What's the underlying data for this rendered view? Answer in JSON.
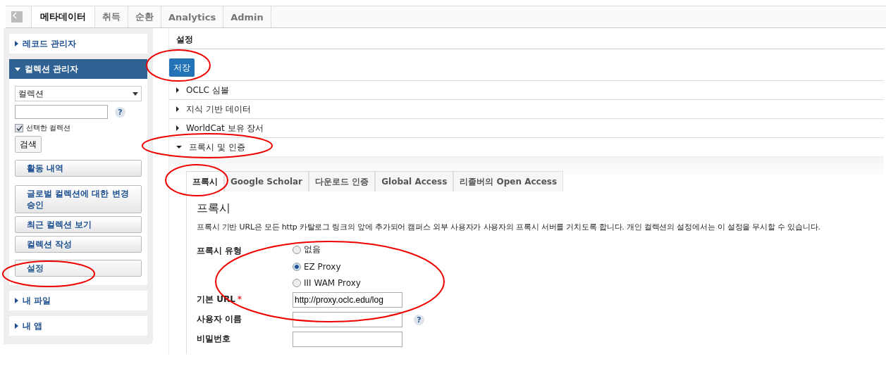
{
  "nav": {
    "tabs": [
      {
        "label": "메타데이터",
        "selected": true
      },
      {
        "label": "취득",
        "selected": false
      },
      {
        "label": "순환",
        "selected": false
      },
      {
        "label": "Analytics",
        "selected": false
      },
      {
        "label": "Admin",
        "selected": false
      }
    ]
  },
  "sidebar": {
    "panels": [
      {
        "title": "레코드 관리자",
        "expanded": false
      },
      {
        "title": "컬렉션 관리자",
        "expanded": true,
        "select": "컬렉션",
        "help": "?",
        "checkbox": {
          "label": "선택한 컬렉션",
          "checked": true
        },
        "search_button": "검색",
        "buttons": [
          {
            "label": "활동 내역",
            "selected": false
          },
          {
            "label": "글로벌 컬렉션에 대한 변경 승인",
            "selected": false
          },
          {
            "label": "최근 컬렉션 보기",
            "selected": false
          },
          {
            "label": "컬렉션 작성",
            "selected": false
          },
          {
            "label": "설정",
            "selected": true
          }
        ]
      },
      {
        "title": "내 파일",
        "expanded": false
      },
      {
        "title": "내 앱",
        "expanded": false
      }
    ]
  },
  "main": {
    "title": "설정",
    "save_button": "저장",
    "sections": [
      {
        "title": "OCLC 심볼",
        "expanded": false
      },
      {
        "title": "지식 기반 데이터",
        "expanded": false
      },
      {
        "title": "WorldCat 보유 장서",
        "expanded": false
      },
      {
        "title": "프록시 및 인증",
        "expanded": true
      }
    ],
    "tabs": [
      {
        "label": "프록시",
        "selected": true
      },
      {
        "label": "Google Scholar",
        "selected": false
      },
      {
        "label": "다운로드 인증",
        "selected": false
      },
      {
        "label": "Global Access",
        "selected": false
      },
      {
        "label": "리졸버의 Open Access",
        "selected": false
      }
    ],
    "panel": {
      "heading": "프록시",
      "description": "프록시 기반 URL은 모든 http 카탈로그 링크의 앞에 추가되어 캠퍼스 외부 사용자가 사용자의 프록시 서버를 거치도록 합니다. 개인 컬렉션의 설정에서는 이 설정을 무시할 수 있습니다.",
      "proxy_type": {
        "label": "프록시 유형",
        "options": [
          {
            "label": "없음",
            "selected": false
          },
          {
            "label": "EZ Proxy",
            "selected": true
          },
          {
            "label": "III WAM Proxy",
            "selected": false
          }
        ]
      },
      "fields": [
        {
          "label": "기본 URL",
          "required": "*",
          "value": "http://proxy.oclc.edu/log"
        },
        {
          "label": "사용자 이름",
          "help": "?"
        },
        {
          "label": "비밀번호"
        }
      ]
    }
  }
}
